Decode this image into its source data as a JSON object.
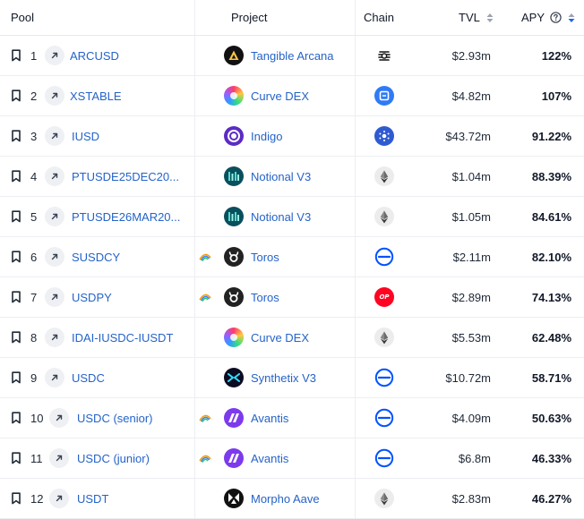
{
  "header": {
    "pool": "Pool",
    "project": "Project",
    "chain": "Chain",
    "tvl": "TVL",
    "apy": "APY",
    "tvl_sort_icon": "sort-both-icon",
    "apy_sort_icon": "sort-desc-icon",
    "apy_help_icon": "question-circle-icon"
  },
  "rows": [
    {
      "rank": "1",
      "pool": "ARCUSD",
      "project": "Tangible Arcana",
      "project_icon": "tangible-logo",
      "chain_icon": "ethena-chain-icon",
      "tvl": "$2.93m",
      "apy": "122%",
      "reward_icon": false
    },
    {
      "rank": "2",
      "pool": "XSTABLE",
      "project": "Curve DEX",
      "project_icon": "curve-logo",
      "chain_icon": "zksync-chain-icon",
      "tvl": "$4.82m",
      "apy": "107%",
      "reward_icon": false
    },
    {
      "rank": "3",
      "pool": "IUSD",
      "project": "Indigo",
      "project_icon": "indigo-logo",
      "chain_icon": "cardano-chain-icon",
      "tvl": "$43.72m",
      "apy": "91.22%",
      "reward_icon": false
    },
    {
      "rank": "4",
      "pool": "PTUSDE25DEC20...",
      "project": "Notional V3",
      "project_icon": "notional-logo",
      "chain_icon": "ethereum-chain-icon",
      "tvl": "$1.04m",
      "apy": "88.39%",
      "reward_icon": false
    },
    {
      "rank": "5",
      "pool": "PTUSDE26MAR20...",
      "project": "Notional V3",
      "project_icon": "notional-logo",
      "chain_icon": "ethereum-chain-icon",
      "tvl": "$1.05m",
      "apy": "84.61%",
      "reward_icon": false
    },
    {
      "rank": "6",
      "pool": "SUSDCY",
      "project": "Toros",
      "project_icon": "toros-logo",
      "chain_icon": "base-chain-icon",
      "tvl": "$2.11m",
      "apy": "82.10%",
      "reward_icon": true
    },
    {
      "rank": "7",
      "pool": "USDPY",
      "project": "Toros",
      "project_icon": "toros-logo",
      "chain_icon": "optimism-chain-icon",
      "tvl": "$2.89m",
      "apy": "74.13%",
      "reward_icon": true
    },
    {
      "rank": "8",
      "pool": "IDAI-IUSDC-IUSDT",
      "project": "Curve DEX",
      "project_icon": "curve-logo",
      "chain_icon": "ethereum-chain-icon",
      "tvl": "$5.53m",
      "apy": "62.48%",
      "reward_icon": false
    },
    {
      "rank": "9",
      "pool": "USDC",
      "project": "Synthetix V3",
      "project_icon": "synthetix-logo",
      "chain_icon": "base-chain-icon",
      "tvl": "$10.72m",
      "apy": "58.71%",
      "reward_icon": false
    },
    {
      "rank": "10",
      "pool": "USDC (senior)",
      "project": "Avantis",
      "project_icon": "avantis-logo",
      "chain_icon": "base-chain-icon",
      "tvl": "$4.09m",
      "apy": "50.63%",
      "reward_icon": true
    },
    {
      "rank": "11",
      "pool": "USDC (junior)",
      "project": "Avantis",
      "project_icon": "avantis-logo",
      "chain_icon": "base-chain-icon",
      "tvl": "$6.8m",
      "apy": "46.33%",
      "reward_icon": true
    },
    {
      "rank": "12",
      "pool": "USDT",
      "project": "Morpho Aave",
      "project_icon": "morpho-logo",
      "chain_icon": "ethereum-chain-icon",
      "tvl": "$2.83m",
      "apy": "46.27%",
      "reward_icon": false
    }
  ],
  "colors": {
    "link": "#2563c9",
    "border": "#eceef2",
    "optimism": "#ff0420",
    "base": "#0052ff",
    "apy_sort_active": "#2563eb"
  }
}
